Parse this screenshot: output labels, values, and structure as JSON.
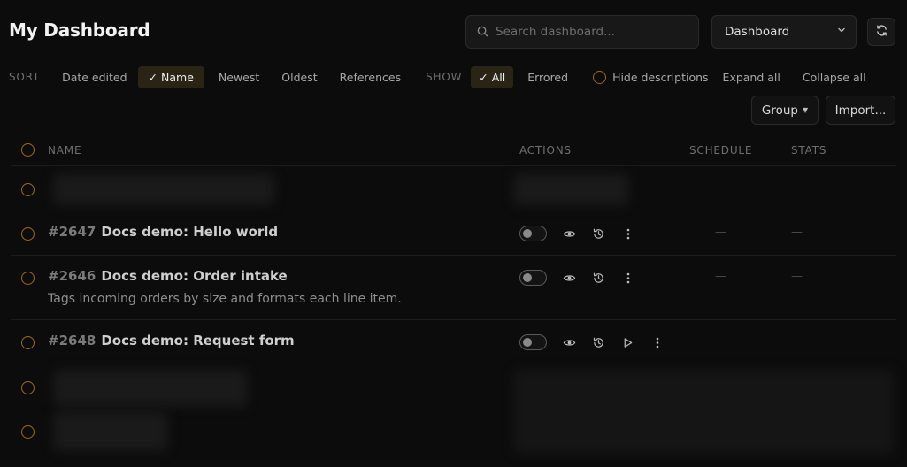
{
  "header": {
    "title": "My Dashboard",
    "search_placeholder": "Search dashboard...",
    "view_select": "Dashboard"
  },
  "filters": {
    "sort_label": "SORT",
    "sort_options": [
      "Date edited",
      "Name",
      "Newest",
      "Oldest",
      "References"
    ],
    "sort_selected": "Name",
    "show_label": "SHOW",
    "show_options": [
      "All",
      "Errored"
    ],
    "show_selected": "All",
    "hide_descriptions": "Hide descriptions",
    "expand_all": "Expand all",
    "collapse_all": "Collapse all"
  },
  "toolbar": {
    "group_label": "Group",
    "import_label": "Import..."
  },
  "table": {
    "columns": {
      "name": "NAME",
      "actions": "ACTIONS",
      "schedule": "SCHEDULE",
      "stats": "STATS"
    },
    "rows": [
      {
        "id": "#2647",
        "name": "Docs demo: Hello world",
        "description": "",
        "schedule": "—",
        "stats": "—",
        "enabled": false,
        "has_run": false
      },
      {
        "id": "#2646",
        "name": "Docs demo: Order intake",
        "description": "Tags incoming orders by size and formats each line item.",
        "schedule": "—",
        "stats": "—",
        "enabled": false,
        "has_run": false
      },
      {
        "id": "#2648",
        "name": "Docs demo: Request form",
        "description": "",
        "schedule": "—",
        "stats": "—",
        "enabled": false,
        "has_run": true
      }
    ]
  },
  "colors": {
    "background": "#0c0c0c",
    "accent_ring": "#9a6c1c",
    "active_chip": "#2a2415"
  },
  "icons": [
    "search-icon",
    "chevron-down-icon",
    "refresh-icon",
    "check-icon",
    "eye-icon",
    "history-icon",
    "play-icon",
    "more-vertical-icon",
    "caret-down-icon"
  ]
}
